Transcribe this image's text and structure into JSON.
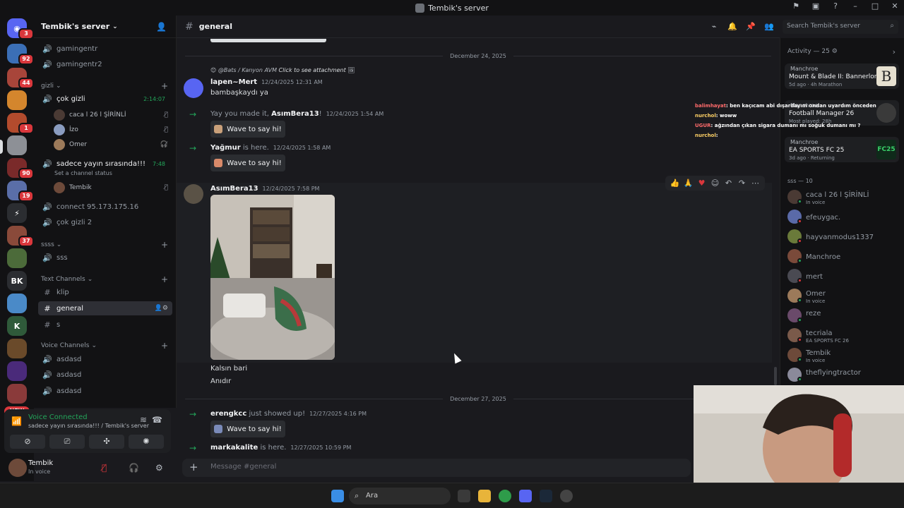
{
  "window": {
    "title": "Tembik's server"
  },
  "server": {
    "name": "Tembik's server"
  },
  "rail": {
    "badges": [
      "3",
      "92",
      "44",
      "1",
      "90",
      "19",
      "37"
    ],
    "initials": "BK",
    "new_label": "NEW"
  },
  "channels": {
    "top": [
      {
        "label": "gamingentr"
      },
      {
        "label": "gamingentr2"
      }
    ],
    "gizli_category": "gizli",
    "gizli_channel": "çok gizli",
    "gizli_timer": "2:14:07",
    "gizli_users": [
      "caca l 26 l ŞİRİNLİ",
      "İzo",
      "Omer"
    ],
    "live_channel": "sadece yayın sırasında!!!",
    "live_timer": "7:48",
    "live_status": "Set a channel status",
    "live_users": [
      "Tembik"
    ],
    "other": [
      {
        "label": "connect 95.173.175.16"
      },
      {
        "label": "çok gizli 2"
      }
    ],
    "ssss_category": "ssss",
    "ssss_channel": "sss",
    "text_category": "Text Channels",
    "text_channels": [
      "klip",
      "general",
      "s"
    ],
    "voice_category": "Voice Channels",
    "voice_channels": [
      "asdasd",
      "asdasd",
      "asdasd"
    ]
  },
  "voice_connected": {
    "title": "Voice Connected",
    "subtitle": "sadece yayın sırasında!!! / Tembik's server"
  },
  "user_panel": {
    "name": "Tembik",
    "status": "In voice"
  },
  "header": {
    "channel": "general",
    "search_placeholder": "Search Tembik's server"
  },
  "messages": {
    "date1": "December 24, 2025",
    "reply_to": "@Bats / Kanyon AVM",
    "reply_attachment": "Click to see attachment",
    "m1_author": "lapen~Mert",
    "m1_time": "12/24/2025 12:31 AM",
    "m1_text": "bambaşkaydı ya",
    "sys1_pre": "Yay you made it,",
    "sys1_user": "AsımBera13",
    "sys1_post": "!",
    "sys1_time": "12/24/2025 1:54 AM",
    "sys2_user": "Yağmur",
    "sys2_post": "is here.",
    "sys2_time": "12/24/2025 1:58 AM",
    "wave_label": "Wave to say hi!",
    "m2_author": "AsımBera13",
    "m2_time": "12/24/2025 7:58 PM",
    "m2_line1": "Kalsın bari",
    "m2_line2": "Anıdır",
    "date2": "December 27, 2025",
    "sys3_user": "erengkcc",
    "sys3_post": "just showed up!",
    "sys3_time": "12/27/2025 4:16 PM",
    "sys4_user": "markakalite",
    "sys4_post": "is here.",
    "sys4_time": "12/27/2025 10:59 PM"
  },
  "composer": {
    "placeholder": "Message #general"
  },
  "activity": {
    "header": "Activity — 25",
    "cards": [
      {
        "who": "Manchroe",
        "game": "Mount & Blade II: Bannerlord",
        "meta": "5d ago  ·  4h Marathon"
      },
      {
        "who": "Manchroe",
        "game": "Football Manager 26",
        "meta": "Most played: 28h"
      },
      {
        "who": "Manchroe",
        "game": "EA SPORTS FC 25",
        "meta": "3d ago  ·  Returning"
      }
    ]
  },
  "members": {
    "header": "sss — 10",
    "list": [
      {
        "name": "caca l 26 l ŞİRİNLİ",
        "sub": "In voice"
      },
      {
        "name": "efeuygac.",
        "sub": ""
      },
      {
        "name": "hayvanmodus1337",
        "sub": ""
      },
      {
        "name": "Manchroe",
        "sub": ""
      },
      {
        "name": "mert",
        "sub": ""
      },
      {
        "name": "Omer",
        "sub": "In voice"
      },
      {
        "name": "reze",
        "sub": ""
      },
      {
        "name": "tecriala",
        "sub": "EA SPORTS FC 26"
      },
      {
        "name": "Tembik",
        "sub": "In voice"
      },
      {
        "name": "theflyingtractor",
        "sub": ""
      }
    ]
  },
  "overlay_chat": [
    {
      "user": "balimhayat",
      "text": ": ben kaçıcam abi dışardayım ondan uyardım önceden"
    },
    {
      "user": "nurchol",
      "text": ": woww"
    },
    {
      "user": "UGUR",
      "text": ": ağzından çıkan sigara dumanı mı soğuk dumanı mı ?"
    },
    {
      "user": "nurchol",
      "text": ":"
    }
  ],
  "taskbar": {
    "search_label": "Ara"
  },
  "colors": {
    "online": "#23a55a",
    "accent": "#5865f2",
    "badge": "#da373c"
  }
}
